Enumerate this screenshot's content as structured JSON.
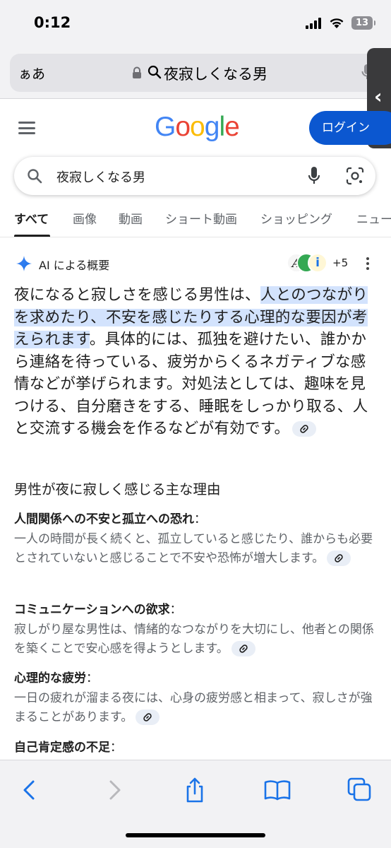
{
  "status_bar": {
    "time": "0:12",
    "battery": "13"
  },
  "address_bar": {
    "text_size_label": "ぁあ",
    "query": "夜寂しくなる男"
  },
  "header": {
    "logo_letters": [
      "G",
      "o",
      "o",
      "g",
      "l",
      "e"
    ],
    "login_label": "ログイン"
  },
  "search": {
    "query": "夜寂しくなる男"
  },
  "tabs": [
    {
      "label": "すべて",
      "active": true
    },
    {
      "label": "画像"
    },
    {
      "label": "動画"
    },
    {
      "label": "ショート動画"
    },
    {
      "label": "ショッピング"
    },
    {
      "label": "ニュー"
    }
  ],
  "ai_overview": {
    "label": "AI による概要",
    "more_sources": "+5",
    "avatar_letters": [
      "A",
      "i"
    ],
    "paragraph": {
      "part1": "夜になると寂しさを感じる男性は、",
      "highlight": "人とのつながりを求めたり、不安を感じたりする心理的な要因が考えられます",
      "part2": "。具体的には、孤独を避けたい、誰かから連絡を待っている、疲労からくるネガティブな感情などが挙げられます。対処法としては、趣味を見つける、自分磨きをする、睡眠をしっかり取る、人と交流する機会を作るなどが有効です。"
    },
    "section_title": "男性が夜に寂しく感じる主な理由",
    "reasons": [
      {
        "title": "人間関係への不安と孤立への恐れ",
        "colon": "：",
        "body": "一人の時間が長く続くと、孤立していると感じたり、誰からも必要とされていないと感じることで不安や恐怖が増大します。"
      },
      {
        "title": "コミュニケーションへの欲求",
        "colon": "：",
        "body": "寂しがり屋な男性は、情緒的なつながりを大切にし、他者との関係を築くことで安心感を得ようとします。"
      },
      {
        "title": "心理的な疲労",
        "colon": "：",
        "body": "一日の疲れが溜まる夜には、心身の疲労感と相まって、寂しさが強まることがあります。"
      },
      {
        "title": "自己肯定感の不足",
        "colon": "："
      }
    ]
  },
  "colors": {
    "accent": "#0b57d0",
    "highlight": "#d3e3fd",
    "muted_text": "#5f6368"
  }
}
